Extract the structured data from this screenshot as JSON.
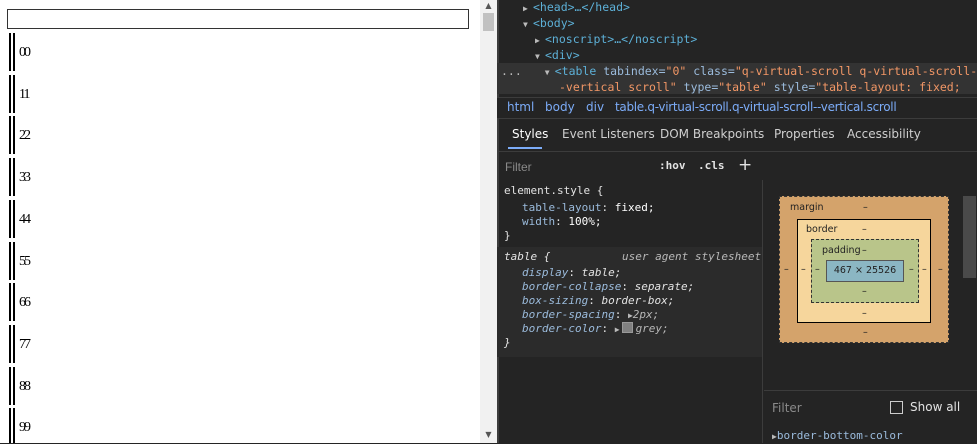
{
  "page": {
    "rows": [
      "00",
      "11",
      "22",
      "33",
      "44",
      "55",
      "66",
      "77",
      "88",
      "99"
    ]
  },
  "devtools": {
    "dom": {
      "head": "<head>…</head>",
      "body_open": "<body>",
      "noscript": "<noscript>…</noscript>",
      "div": "<div>",
      "dots": "...",
      "table_line1_tag": "<table",
      "attr_tabindex": "tabindex",
      "val_tabindex": "\"0\"",
      "attr_class": "class",
      "val_class": "\"q-virtual-scroll q-virtual-scroll-",
      "line2_val": "-vertical scroll\"",
      "attr_type": "type",
      "val_type": "\"table\"",
      "attr_style": "style",
      "val_style": "\"table-layout: fixed;"
    },
    "breadcrumb": [
      "html",
      "body",
      "div",
      "table.q-virtual-scroll.q-virtual-scroll--vertical.scroll"
    ],
    "tabs": [
      "Styles",
      "Event Listeners",
      "DOM Breakpoints",
      "Properties",
      "Accessibility"
    ],
    "filter_placeholder": "Filter",
    "hov": ":hov",
    "cls": ".cls",
    "plus": "+",
    "element_style": {
      "selector": "element.style {",
      "props": [
        {
          "name": "table-layout",
          "value": "fixed;"
        },
        {
          "name": "width",
          "value": "100%;"
        }
      ],
      "close": "}"
    },
    "ua_rule": {
      "selector": "table {",
      "label": "user agent stylesheet",
      "props": [
        {
          "name": "display",
          "value": "table;"
        },
        {
          "name": "border-collapse",
          "value": "separate;"
        },
        {
          "name": "box-sizing",
          "value": "border-box;"
        },
        {
          "name": "border-spacing",
          "value": "2px;"
        },
        {
          "name": "border-color",
          "value": "grey;"
        }
      ],
      "close": "}"
    },
    "box_model": {
      "margin_label": "margin",
      "border_label": "border",
      "padding_label": "padding",
      "dash": "–",
      "content_size": "467 × 25526",
      "colors": {
        "margin": "#d4a36b",
        "border": "#f6d69c",
        "padding": "#b9c58a",
        "content": "#8bb6c3"
      }
    },
    "computed": {
      "filter_placeholder": "Filter",
      "show_all": "Show all",
      "first_prop": "border-bottom-color"
    }
  }
}
